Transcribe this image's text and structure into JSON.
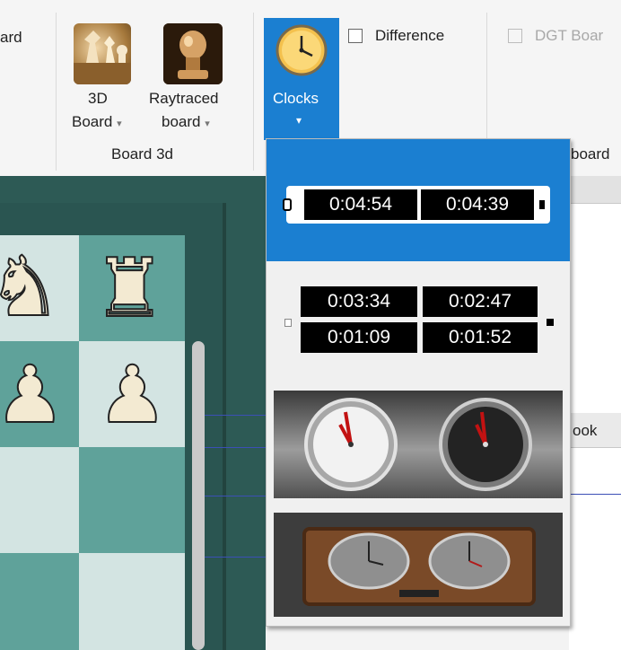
{
  "ribbon": {
    "partial_left_label": "ard",
    "board3d_label_line1": "3D",
    "board3d_label_line2": "Board",
    "raytraced_label_line1": "Raytraced",
    "raytraced_label_line2": "board",
    "group_label": "Board 3d",
    "clocks_label": "Clocks",
    "difference_label": "Difference",
    "dgt_label": "DGT Boar",
    "dgt_group_partial": "board",
    "caret_glyph": "▾"
  },
  "right_pane": {
    "tab_partial": "ook"
  },
  "clock_menu": {
    "option1": {
      "left_time": "0:04:54",
      "right_time": "0:04:39"
    },
    "option2": {
      "top_left": "0:03:34",
      "top_right": "0:02:47",
      "bottom_left": "0:01:09",
      "bottom_right": "0:01:52"
    }
  },
  "board": {
    "pieces": {
      "knight": "♞",
      "rook": "♜",
      "pawn": "♟"
    }
  },
  "colors": {
    "accent": "#1b7fd1",
    "board_light": "#d3e4e2",
    "board_dark": "#5fa29a",
    "frame": "#2d5a55"
  }
}
